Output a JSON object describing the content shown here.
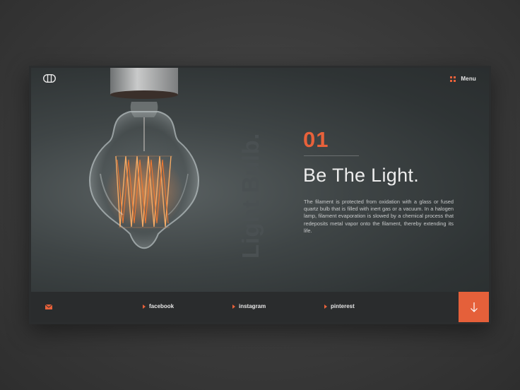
{
  "header": {
    "menu_label": "Menu",
    "logo_icon": "logo-mark"
  },
  "hero": {
    "vertical_word": "Light Bulb.",
    "number": "01",
    "headline": "Be The Light.",
    "body": "The filament is protected from oxidation with a glass or fused quartz bulb that is filled with inert gas or a vacuum. In a halogen lamp, filament evaporation is slowed by a chemical process that redeposits metal vapor onto the filament, thereby extending its life."
  },
  "footer": {
    "mail_icon": "envelope-icon",
    "social": [
      {
        "label": "facebook"
      },
      {
        "label": "instagram"
      },
      {
        "label": "pinterest"
      }
    ],
    "down_icon": "arrow-down-icon"
  },
  "colors": {
    "accent": "#e5603a",
    "background": "#2b2d2e",
    "text": "#ececec"
  }
}
